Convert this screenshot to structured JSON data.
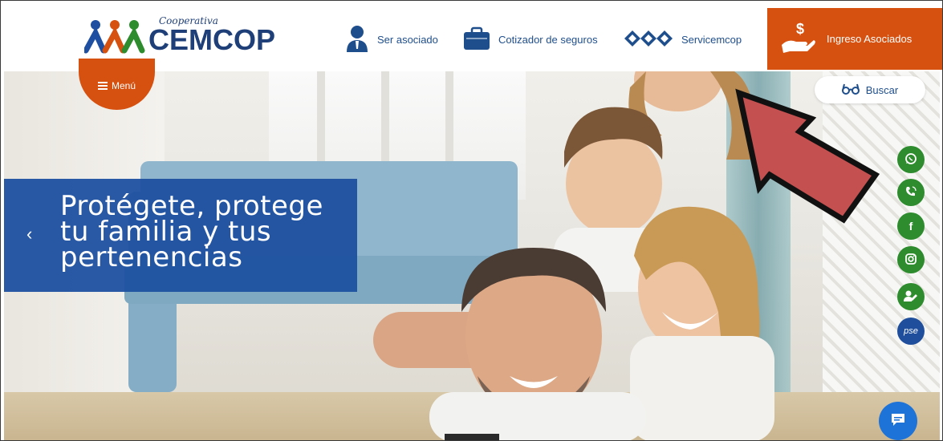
{
  "header": {
    "logo": {
      "small_text": "Cooperativa",
      "big_text": "CEMCOP"
    },
    "nav": [
      {
        "label": "Ser asociado",
        "icon": "user-tie-icon"
      },
      {
        "label": "Cotizador de seguros",
        "icon": "briefcase-icon"
      },
      {
        "label": "Servicemcop",
        "icon": "diamond-chain-icon"
      }
    ],
    "ingreso": {
      "label": "Ingreso Asociados",
      "icon": "hand-money-icon"
    }
  },
  "menu": {
    "label": "Menú"
  },
  "search": {
    "label": "Buscar",
    "icon": "glasses-icon"
  },
  "slide": {
    "title": "Protégete, protege tu familia y tus pertenencias",
    "prev_icon": "chevron-left-icon"
  },
  "social": [
    {
      "name": "whatsapp",
      "icon": "whatsapp-icon"
    },
    {
      "name": "phone",
      "icon": "phone-icon"
    },
    {
      "name": "facebook",
      "icon": "facebook-icon",
      "glyph": "f"
    },
    {
      "name": "instagram",
      "icon": "instagram-icon"
    },
    {
      "name": "user-edit",
      "icon": "user-edit-icon"
    },
    {
      "name": "pse",
      "icon": "pse-icon",
      "glyph": "pse"
    }
  ],
  "colors": {
    "brand_blue": "#1e3f78",
    "accent_orange": "#d6500f",
    "social_green": "#2e8b2e",
    "caption_blue": "#1e50a0",
    "chat_blue": "#1e73d8",
    "annotation_red": "#c45050"
  }
}
